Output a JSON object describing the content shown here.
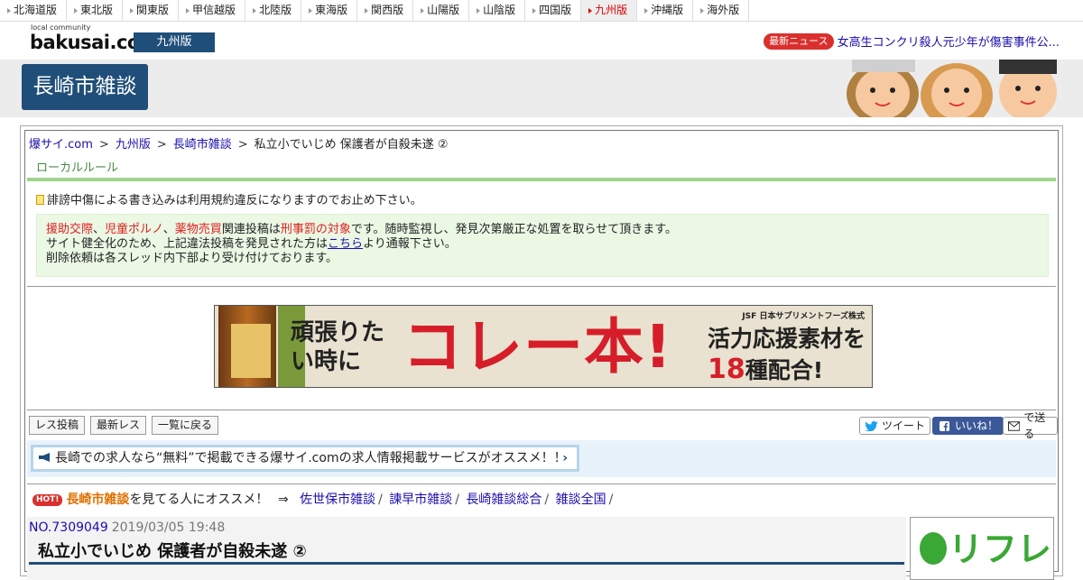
{
  "regions": [
    {
      "label": "北海道版",
      "active": false
    },
    {
      "label": "東北版",
      "active": false
    },
    {
      "label": "関東版",
      "active": false
    },
    {
      "label": "甲信越版",
      "active": false
    },
    {
      "label": "北陸版",
      "active": false
    },
    {
      "label": "東海版",
      "active": false
    },
    {
      "label": "関西版",
      "active": false
    },
    {
      "label": "山陽版",
      "active": false
    },
    {
      "label": "山陰版",
      "active": false
    },
    {
      "label": "四国版",
      "active": false
    },
    {
      "label": "九州版",
      "active": true
    },
    {
      "label": "沖縄版",
      "active": false
    },
    {
      "label": "海外版",
      "active": false
    }
  ],
  "header": {
    "logo_small": "local community",
    "logo_main": "bakusai",
    "logo_dot": ".com",
    "region_badge": "九州版",
    "news_badge": "最新ニュース",
    "news_text": "女高生コンクリ殺人元少年が傷害事件公..."
  },
  "banner": {
    "board_title": "長崎市雑談"
  },
  "breadcrumb": {
    "site": "爆サイ.com",
    "region": "九州版",
    "board": "長崎市雑談",
    "separator": ">",
    "current": "私立小でいじめ 保護者が自殺未遂 ②"
  },
  "local_rule": {
    "heading": "ローカルルール",
    "warning": "誹謗中傷による書き込みは利用規約違反になりますのでお止め下さい。",
    "notice": {
      "w1": "援助交際",
      "w2": "児童ポルノ",
      "w3": "薬物売買",
      "comma": "、",
      "mid": "関連投稿は",
      "w4": "刑事罰の対象",
      "tail": "です。随時監視し、発見次第厳正な処置を取らせて頂きます。",
      "line2_a": "サイト健全化のため、上記違法投稿を発見された方は",
      "line2_link": "こちら",
      "line2_b": "より通報下さい。",
      "line3": "削除依頼は各スレッド内下部より受け付けております。"
    }
  },
  "ad": {
    "text1": "頑張りたい時に",
    "text2": "コレー本!",
    "brand": "JSF 日本サプリメントフーズ株式",
    "text3a": "活力応援素材を",
    "text3_num": "18",
    "text3b": "種配合!"
  },
  "toolbar": {
    "reply": "レス投稿",
    "latest": "最新レス",
    "back": "一覧に戻る",
    "tweet": "ツイート",
    "like": "いいね！",
    "send": "で送る"
  },
  "job": {
    "text": "長崎での求人なら“無料”で掲載できる爆サイ.comの求人情報掲載サービスがオススメ！！",
    "arrow": "›"
  },
  "hot": {
    "badge": "HOT!",
    "name": "長崎市雑談",
    "suffix": "を見てる人にオススメ！",
    "arrow": "⇒",
    "links": [
      "佐世保市雑談",
      "諫早市雑談",
      "長崎雑談総合",
      "雑談全国"
    ],
    "slash": "/"
  },
  "post": {
    "number": "NO.7309049",
    "date": "2019/03/05 19:48",
    "title": "私立小でいじめ 保護者が自殺未遂 ②"
  },
  "side_ad": {
    "brand": "リフレ"
  },
  "colors": {
    "navy": "#1f4e79",
    "red": "#e02020",
    "green": "#9ed58b",
    "link": "#1a0dab"
  }
}
